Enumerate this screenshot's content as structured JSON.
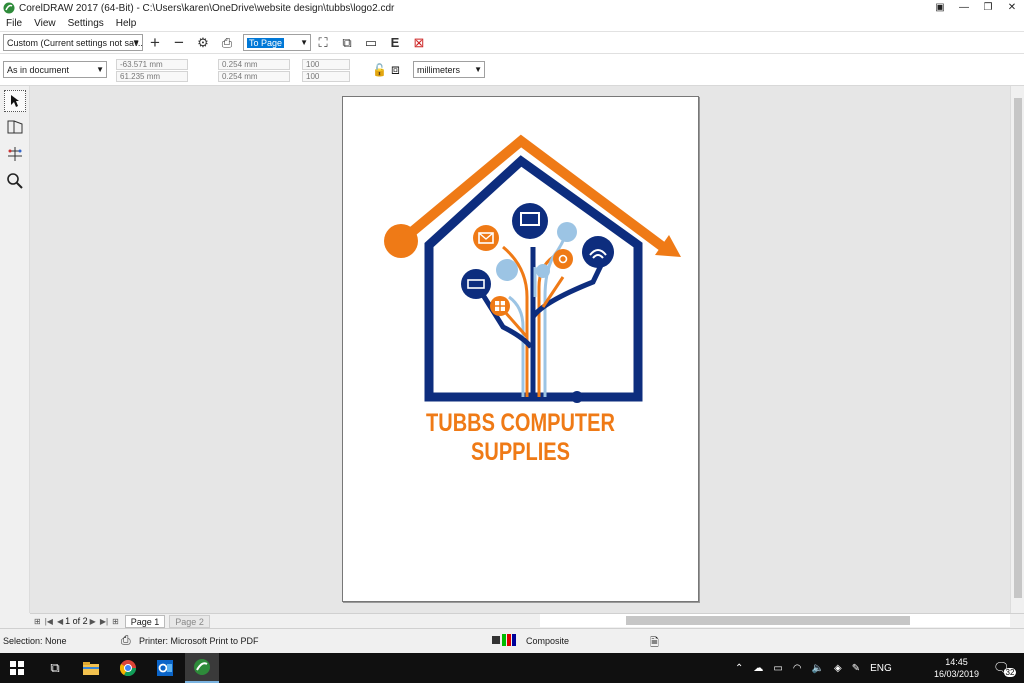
{
  "window": {
    "title": "CorelDRAW 2017 (64-Bit) - C:\\Users\\karen\\OneDrive\\website design\\tubbs\\logo2.cdr"
  },
  "menu": [
    "File",
    "View",
    "Settings",
    "Help"
  ],
  "toolbar": {
    "preset": "Custom (Current settings not sav...",
    "zoom": "To Page"
  },
  "property_bar": {
    "position_select": "As in document",
    "x": "-63.571 mm",
    "y": "61.235 mm",
    "width": "0.254 mm",
    "height": "0.254 mm",
    "scale_x": "100",
    "scale_y": "100",
    "units": "millimeters"
  },
  "document": {
    "logo_text": "TUBBS COMPUTER SUPPLIES",
    "colors": {
      "orange": "#ef7a16",
      "navy": "#0d2d7e",
      "light_blue": "#9cc4e4"
    }
  },
  "pages": {
    "current": "1",
    "of_label": "of",
    "total": "2",
    "tabs": [
      "Page 1",
      "Page 2"
    ]
  },
  "status": {
    "selection": "Selection: None",
    "printer": "Printer: Microsoft Print to PDF",
    "mode": "Composite"
  },
  "taskbar": {
    "lang": "ENG",
    "time": "14:45",
    "date": "16/03/2019",
    "notifications": "32"
  }
}
